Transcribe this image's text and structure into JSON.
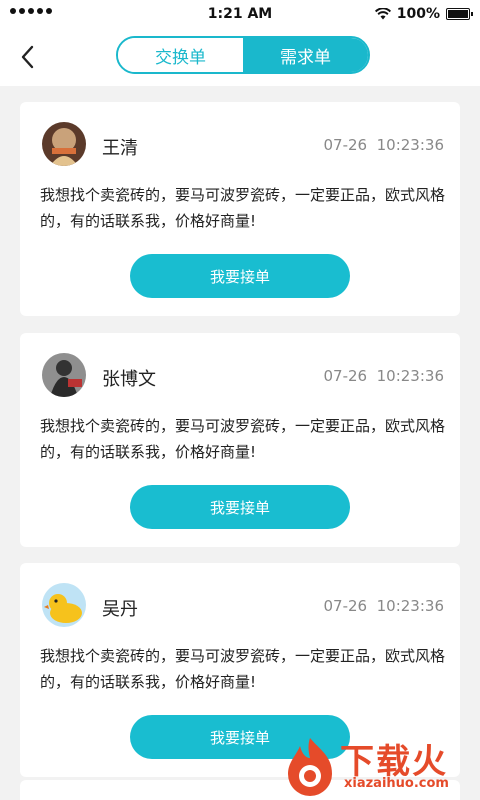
{
  "status_bar": {
    "time": "1:21 AM",
    "battery": "100%"
  },
  "nav": {
    "tabs": [
      {
        "label": "交换单",
        "active": false
      },
      {
        "label": "需求单",
        "active": true
      }
    ]
  },
  "cards": [
    {
      "name": "王清",
      "datetime": "07-26  10:23:36",
      "content": "我想找个卖瓷砖的，要马可波罗瓷砖，一定要正品，欧式风格的，有的话联系我，价格好商量!",
      "button": "我要接单"
    },
    {
      "name": "张博文",
      "datetime": "07-26  10:23:36",
      "content": "我想找个卖瓷砖的，要马可波罗瓷砖，一定要正品，欧式风格的，有的话联系我，价格好商量!",
      "button": "我要接单"
    },
    {
      "name": "吴丹",
      "datetime": "07-26  10:23:36",
      "content": "我想找个卖瓷砖的，要马可波罗瓷砖，一定要正品，欧式风格的，有的话联系我，价格好商量!",
      "button": "我要接单"
    }
  ],
  "watermark": {
    "title": "下载火",
    "url": "xiazaihuo.com"
  },
  "colors": {
    "accent": "#19bdd0",
    "background": "#f2f2f2",
    "watermark": "#e54b2a"
  }
}
